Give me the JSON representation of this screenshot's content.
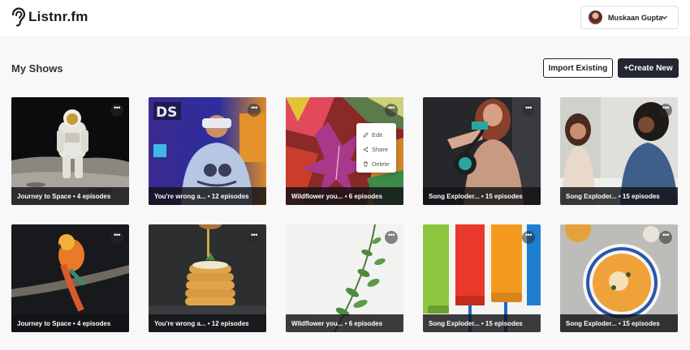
{
  "app": {
    "logo_text": "Listnr.fm"
  },
  "user": {
    "name": "Muskaan Gupta"
  },
  "page": {
    "title": "My Shows"
  },
  "actions": {
    "import_label": "Import Existing",
    "create_label": "+Create New"
  },
  "context_menu": {
    "edit": "Edit",
    "share": "Share",
    "delete": "Delete"
  },
  "shows": [
    {
      "caption": "Journey to Space • 4 episodes",
      "image": "astronaut on moon"
    },
    {
      "caption": "You're wrong a... • 12 episodes",
      "image": "kid with vr headset"
    },
    {
      "caption": "Wildflower you... • 6 episodes",
      "image": "autumn leaves"
    },
    {
      "caption": "Song Exploder... • 15 episodes",
      "image": "woman with headphones"
    },
    {
      "caption": "Song Exploder... • 15 episodes",
      "image": "two women talking"
    },
    {
      "caption": "Journey to Space • 4 episodes",
      "image": "parrot on branch"
    },
    {
      "caption": "You're wrong a... • 12 episodes",
      "image": "pancake stack"
    },
    {
      "caption": "Wildflower you... • 6 episodes",
      "image": "green plant"
    },
    {
      "caption": "Song Exploder... • 15 episodes",
      "image": "paint rollers"
    },
    {
      "caption": "Song Exploder... • 15 episodes",
      "image": "pumpkin soup"
    }
  ],
  "colors": {
    "primary_button": "#232733",
    "caption_bg": "#121216",
    "page_bg": "#f8f8f9"
  }
}
